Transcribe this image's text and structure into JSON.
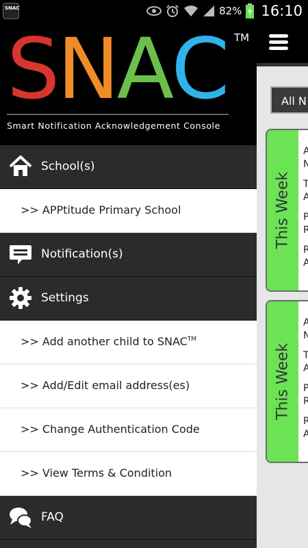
{
  "status_bar": {
    "app_icon_text": "SNAC",
    "battery_percent": "82%",
    "time": "16:10",
    "icons": [
      "eye-icon",
      "alarm-icon",
      "wifi-icon",
      "signal-icon",
      "battery-icon"
    ]
  },
  "logo": {
    "letters": [
      "S",
      "N",
      "A",
      "C"
    ],
    "letter_colors": [
      "#d9352f",
      "#f08c28",
      "#6cc04a",
      "#2fb3e8"
    ],
    "trademark": "TM",
    "subtitle": "Smart Notification Acknowledgement Console"
  },
  "drawer": {
    "schools_label": "School(s)",
    "school_item": ">> APPtitude Primary School",
    "notifications_label": "Notification(s)",
    "settings_label": "Settings",
    "settings_items": {
      "add_child": ">> Add another child to SNAC",
      "add_child_tm": "TM",
      "edit_email": ">> Add/Edit email address(es)",
      "change_auth": ">> Change Authentication Code",
      "view_terms": ">> View Terms & Condition"
    },
    "faq_label": "FAQ"
  },
  "background_page": {
    "filter_label": "All N",
    "cards": [
      {
        "week_label": "This Week",
        "lines": [
          "A\nN",
          "T\nA",
          "P\nR",
          "R\nA"
        ]
      },
      {
        "week_label": "This Week",
        "lines": [
          "A\nN",
          "T\nA",
          "P\nR",
          "R\nA"
        ]
      }
    ]
  }
}
